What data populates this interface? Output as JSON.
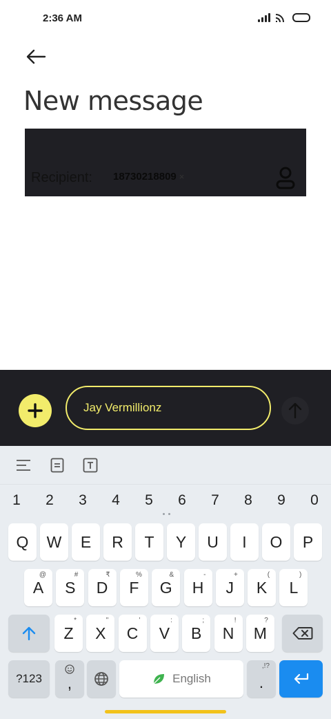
{
  "status_bar": {
    "time": "2:36 AM"
  },
  "header": {
    "title": "New message"
  },
  "recipient": {
    "label": "Recipient:",
    "chip": "18730218809",
    "chip_remove": "×"
  },
  "compose": {
    "message_text": "Jay Vermillionz"
  },
  "keyboard": {
    "numbers": [
      "1",
      "2",
      "3",
      "4",
      "5",
      "6",
      "7",
      "8",
      "9",
      "0"
    ],
    "row1": [
      {
        "key": "Q",
        "hint": ""
      },
      {
        "key": "W",
        "hint": ""
      },
      {
        "key": "E",
        "hint": ""
      },
      {
        "key": "R",
        "hint": ""
      },
      {
        "key": "T",
        "hint": ""
      },
      {
        "key": "Y",
        "hint": ""
      },
      {
        "key": "U",
        "hint": ""
      },
      {
        "key": "I",
        "hint": ""
      },
      {
        "key": "O",
        "hint": ""
      },
      {
        "key": "P",
        "hint": ""
      }
    ],
    "row2": [
      {
        "key": "A",
        "hint": "@"
      },
      {
        "key": "S",
        "hint": "#"
      },
      {
        "key": "D",
        "hint": "₹"
      },
      {
        "key": "F",
        "hint": "%"
      },
      {
        "key": "G",
        "hint": "&"
      },
      {
        "key": "H",
        "hint": "-"
      },
      {
        "key": "J",
        "hint": "+"
      },
      {
        "key": "K",
        "hint": "("
      },
      {
        "key": "L",
        "hint": ")"
      }
    ],
    "row3": [
      {
        "key": "Z",
        "hint": "*"
      },
      {
        "key": "X",
        "hint": "\""
      },
      {
        "key": "C",
        "hint": "'"
      },
      {
        "key": "V",
        "hint": ":"
      },
      {
        "key": "B",
        "hint": ";"
      },
      {
        "key": "N",
        "hint": "!"
      },
      {
        "key": "M",
        "hint": "?"
      }
    ],
    "symbols_label": "?123",
    "comma_label": ",",
    "space_label": "English",
    "period_label": ".",
    "period_hint": ",!?"
  },
  "colors": {
    "accent": "#f2ec6b",
    "dark_panel": "#1f1f24",
    "enter_key": "#1a8cf0",
    "home_indicator": "#f2c21b"
  }
}
